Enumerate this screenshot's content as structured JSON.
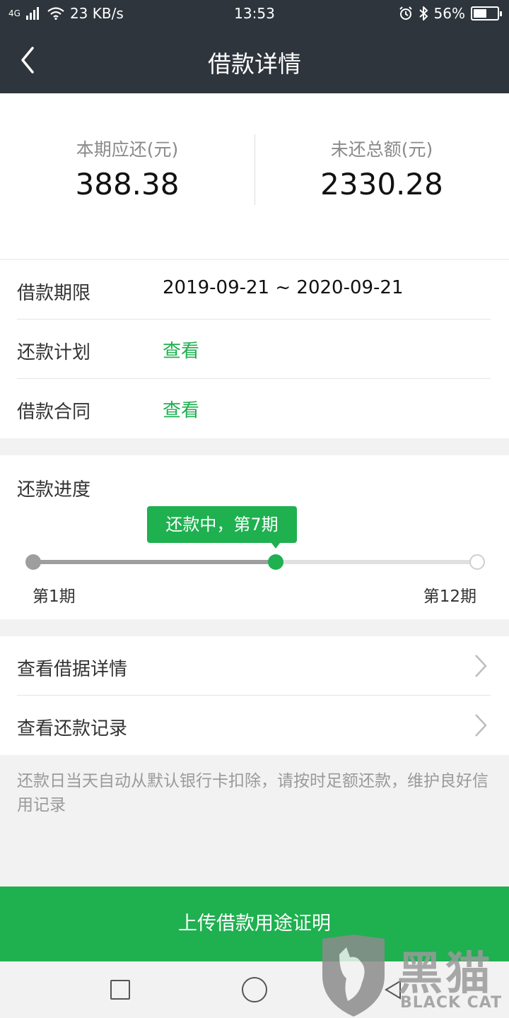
{
  "status_bar": {
    "network": "4G",
    "speed": "23 KB/s",
    "time": "13:53",
    "battery": "56%",
    "battery_level": 0.56
  },
  "header": {
    "title": "借款详情"
  },
  "summary": {
    "current_label": "本期应还(元)",
    "current_amount": "388.38",
    "total_label": "未还总额(元)",
    "total_amount": "2330.28"
  },
  "info_rows": [
    {
      "label": "借款期限",
      "value": "2019-09-21 ~ 2020-09-21"
    },
    {
      "label": "还款计划",
      "value": "查看"
    },
    {
      "label": "借款合同",
      "value": "查看"
    }
  ],
  "progress": {
    "title": "还款进度",
    "tip": "还款中，第7期",
    "start_label": "第1期",
    "end_label": "第12期",
    "current_period": 7,
    "total_periods": 12
  },
  "links": [
    {
      "label": "查看借据详情"
    },
    {
      "label": "查看还款记录"
    }
  ],
  "notice": "还款日当天自动从默认银行卡扣除，请按时足额还款，维护良好信用记录",
  "cta": {
    "label": "上传借款用途证明"
  },
  "watermark": {
    "cn": "黑猫",
    "en": "BLACK CAT"
  },
  "colors": {
    "accent": "#1fb050",
    "header_bg": "#2e353c"
  }
}
